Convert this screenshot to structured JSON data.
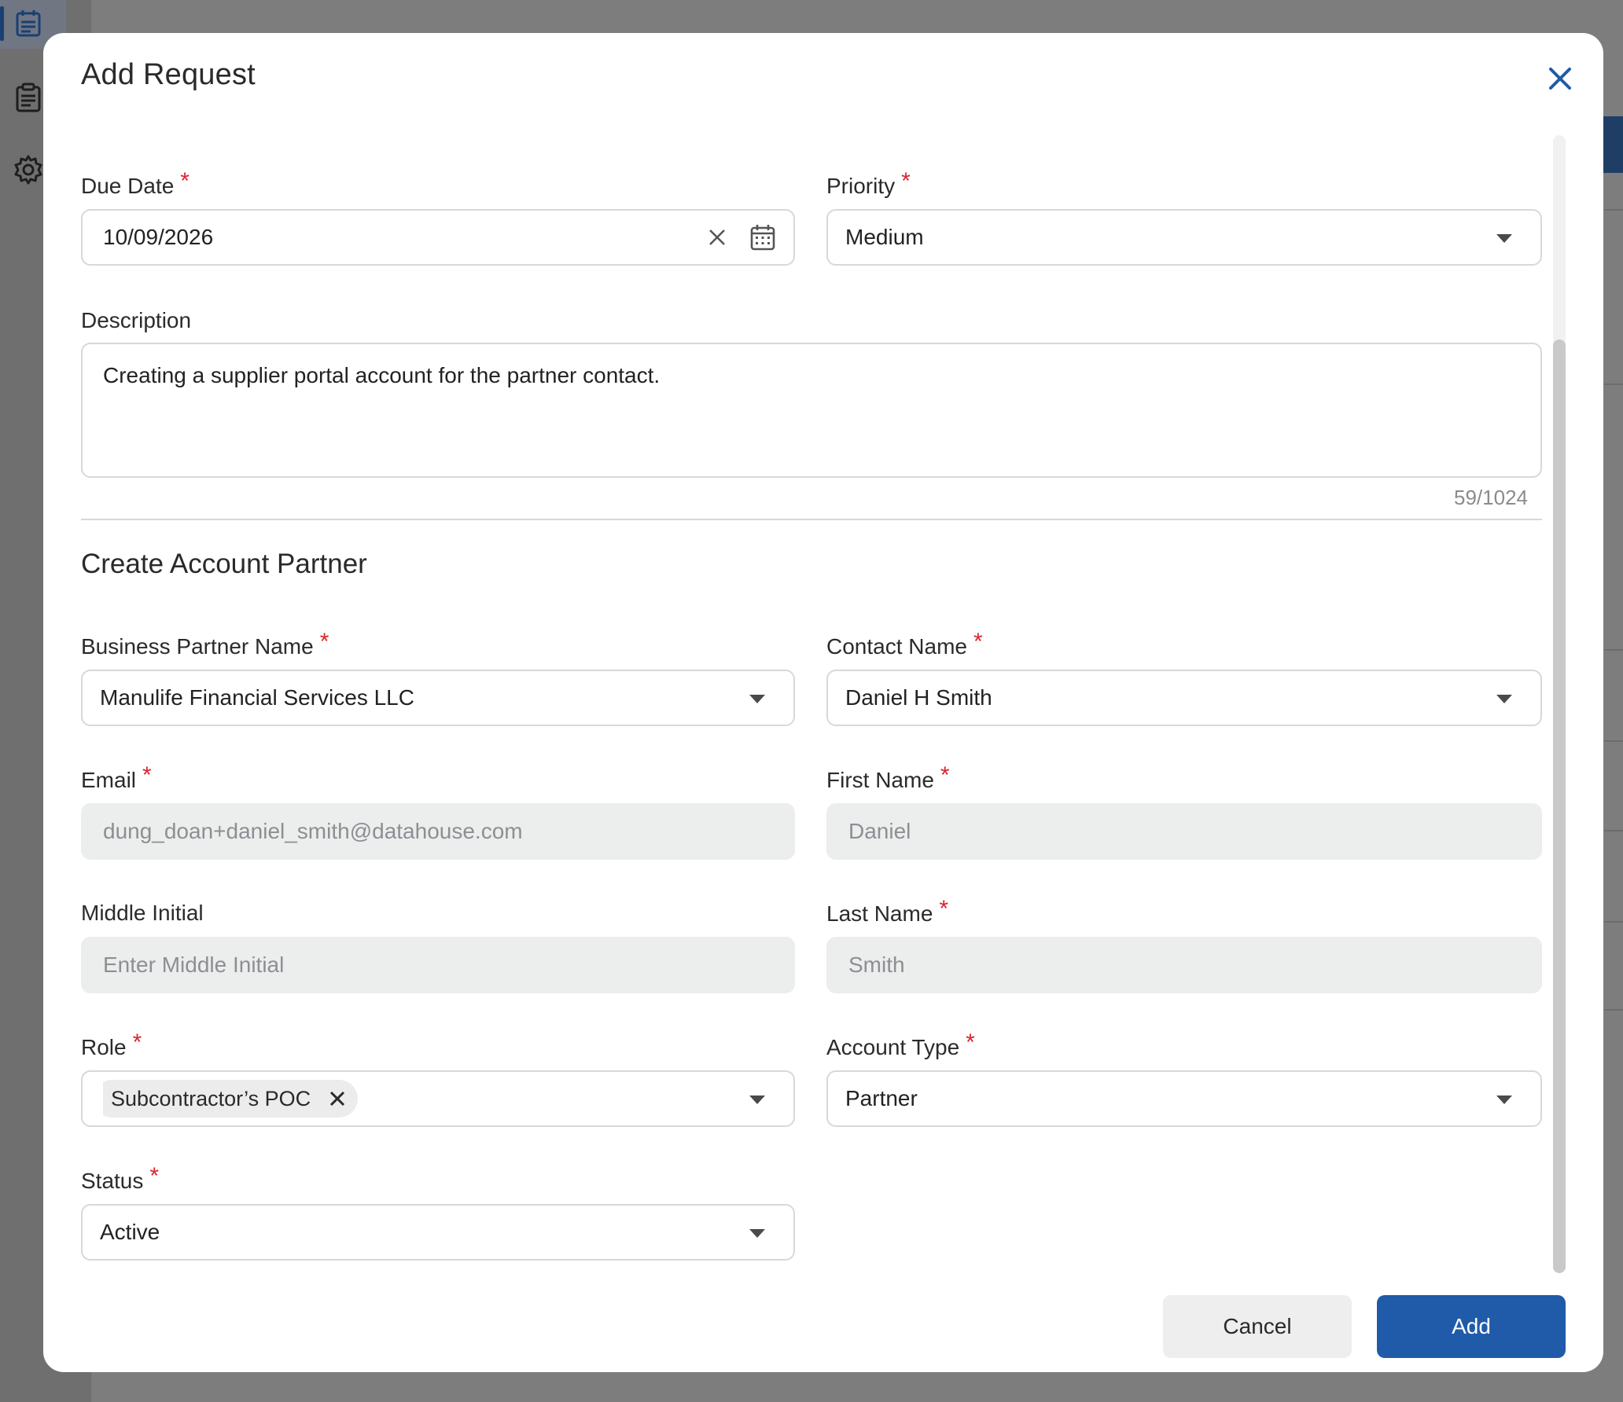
{
  "modal": {
    "title": "Add Request",
    "close_icon": "close-icon",
    "accent_color": "#1f5ba8",
    "required_mark": "*",
    "required_color": "#d9262e"
  },
  "request": {
    "due_date": {
      "label": "Due Date",
      "value": "10/09/2026"
    },
    "priority": {
      "label": "Priority",
      "value": "Medium"
    },
    "description": {
      "label": "Description",
      "value": "Creating a supplier portal account for the partner contact.",
      "counter": "59/1024"
    }
  },
  "section": {
    "title": "Create Account Partner"
  },
  "partner": {
    "business_partner_name": {
      "label": "Business Partner Name",
      "value": "Manulife Financial Services LLC"
    },
    "contact_name": {
      "label": "Contact Name",
      "value": "Daniel H Smith"
    },
    "email": {
      "label": "Email",
      "value": "dung_doan+daniel_smith@datahouse.com"
    },
    "first_name": {
      "label": "First Name",
      "value": "Daniel"
    },
    "middle_initial": {
      "label": "Middle Initial",
      "placeholder": "Enter Middle Initial"
    },
    "last_name": {
      "label": "Last Name",
      "value": "Smith"
    },
    "role": {
      "label": "Role",
      "chips": [
        "Subcontractor’s POC"
      ]
    },
    "account_type": {
      "label": "Account Type",
      "value": "Partner"
    },
    "status": {
      "label": "Status",
      "value": "Active"
    }
  },
  "footer": {
    "cancel_label": "Cancel",
    "add_label": "Add"
  }
}
